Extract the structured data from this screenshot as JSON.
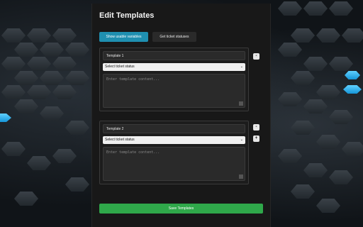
{
  "panel": {
    "title": "Edit Templates",
    "buttons": {
      "show_vars": "Show usable variables",
      "get_status": "Get ticket statuses"
    }
  },
  "templates": [
    {
      "name": "Template 1",
      "status_select": "Select ticket status",
      "content_placeholder": "Enter template content..."
    },
    {
      "name": "Template 2",
      "status_select": "Select ticket status",
      "content_placeholder": "Enter template content..."
    }
  ],
  "side_controls": {
    "remove_symbol": "-",
    "add_symbol": "+"
  },
  "footer": {
    "save_label": "Save Templates"
  },
  "colors": {
    "primary_button": "#1f8fb0",
    "save_button": "#2fa84a",
    "glow": "#33b8ff"
  }
}
